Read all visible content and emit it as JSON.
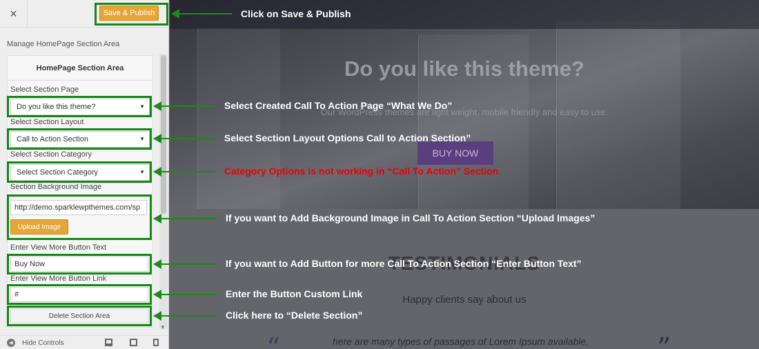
{
  "topbar": {
    "close_icon": "×",
    "save_label": "Save & Publish"
  },
  "panel": {
    "title": "Manage HomePage Section Area"
  },
  "section": {
    "heading": "HomePage Section Area",
    "page_label": "Select Section Page",
    "page_value": "Do you like this theme?",
    "layout_label": "Select Section Layout",
    "layout_value": "Call to Action Section",
    "category_label": "Select Section Category",
    "category_value": "Select Section Category",
    "bg_label": "Section Background Image",
    "bg_value": "http://demo.sparklewpthemes.com/sp",
    "upload_label": "Upload Image",
    "btn_text_label": "Enter View More Button Text",
    "btn_text_value": "Buy Now",
    "btn_link_label": "Enter View More Button Link",
    "btn_link_value": "#",
    "delete_label": "Delete Section Area"
  },
  "footer": {
    "hide_label": "Hide Controls"
  },
  "preview": {
    "hero_title": "Do you like this theme?",
    "hero_sub": "Our WordPress themes are light weight, mobile friendly and easy to use.",
    "buy_label": "BUY NOW",
    "testi_title": "TESTIMONIALS",
    "testi_sub": "Happy clients say about us",
    "quote_text": "here are many types of passages of Lorem Ipsum available,",
    "quote_open": "“",
    "quote_close": "”"
  },
  "annotations": {
    "save": "Click on Save & Publish",
    "page": "Select Created Call To Action Page “What We Do”",
    "layout": "Select Section Layout Options Call to Action Section”",
    "category": "Category Options is not working in “Call To Action” Section",
    "bg": "If you want to Add Background Image in Call To Action Section “Upload Images”",
    "btn_text": "If you want to Add Button for more  Call To Action Section “Enter Button Text”",
    "btn_link": "Enter the Button Custom Link",
    "delete": "Click here to “Delete Section”"
  },
  "colors": {
    "accent_orange": "#e5a537",
    "annotation_green": "#118811",
    "annotation_red": "#ee0000",
    "buy_purple": "#5a3f7e"
  }
}
